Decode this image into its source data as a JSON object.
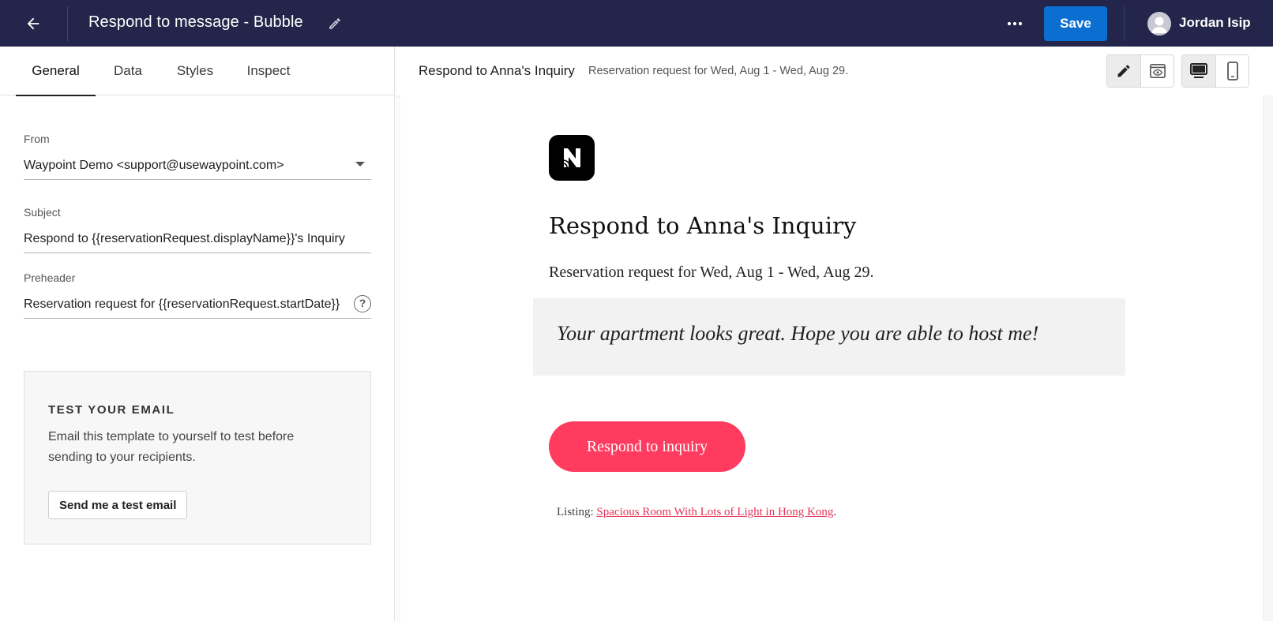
{
  "topbar": {
    "title": "Respond to message - Bubble",
    "save_label": "Save",
    "user_name": "Jordan Isip",
    "bg_color": "#23264a",
    "accent_color": "#0b6fd1"
  },
  "tabs": [
    {
      "label": "General",
      "active": true
    },
    {
      "label": "Data",
      "active": false
    },
    {
      "label": "Styles",
      "active": false
    },
    {
      "label": "Inspect",
      "active": false
    }
  ],
  "form": {
    "from": {
      "label": "From",
      "value": "Waypoint Demo <support@usewaypoint.com>"
    },
    "subject": {
      "label": "Subject",
      "value": "Respond to {{reservationRequest.displayName}}'s Inquiry"
    },
    "preheader": {
      "label": "Preheader",
      "value": "Reservation request for {{reservationRequest.startDate}}"
    },
    "help_glyph": "?"
  },
  "test_email": {
    "title": "TEST YOUR EMAIL",
    "description": "Email this template to yourself to test before sending to your recipients.",
    "button_label": "Send me a test email"
  },
  "preview_header": {
    "title": "Respond to Anna's Inquiry",
    "subtitle": "Reservation request for Wed, Aug 1 - Wed, Aug 29.",
    "mode_selected": "edit",
    "device_selected": "desktop"
  },
  "email": {
    "heading": "Respond to Anna's Inquiry",
    "subheading": "Reservation request for Wed, Aug 1 - Wed, Aug 29.",
    "quote": "Your apartment looks great. Hope you are able to host me!",
    "button_label": "Respond to inquiry",
    "button_color": "#ff3b60",
    "listing_prefix": "Listing: ",
    "listing_link": "Spacious Room With Lots of Light in Hong Kong",
    "listing_suffix": ".",
    "link_color": "#e4335a"
  },
  "icons": {
    "back": "back-arrow-icon",
    "rename": "pencil-icon",
    "more": "more-horizontal-icon",
    "avatar": "user-avatar-icon",
    "dropdown": "chevron-down-icon",
    "help": "help-circle-icon",
    "edit_mode": "pencil-icon",
    "preview_mode": "eye-icon",
    "desktop": "desktop-icon",
    "mobile": "mobile-icon",
    "logo": "brand-logo-icon"
  }
}
